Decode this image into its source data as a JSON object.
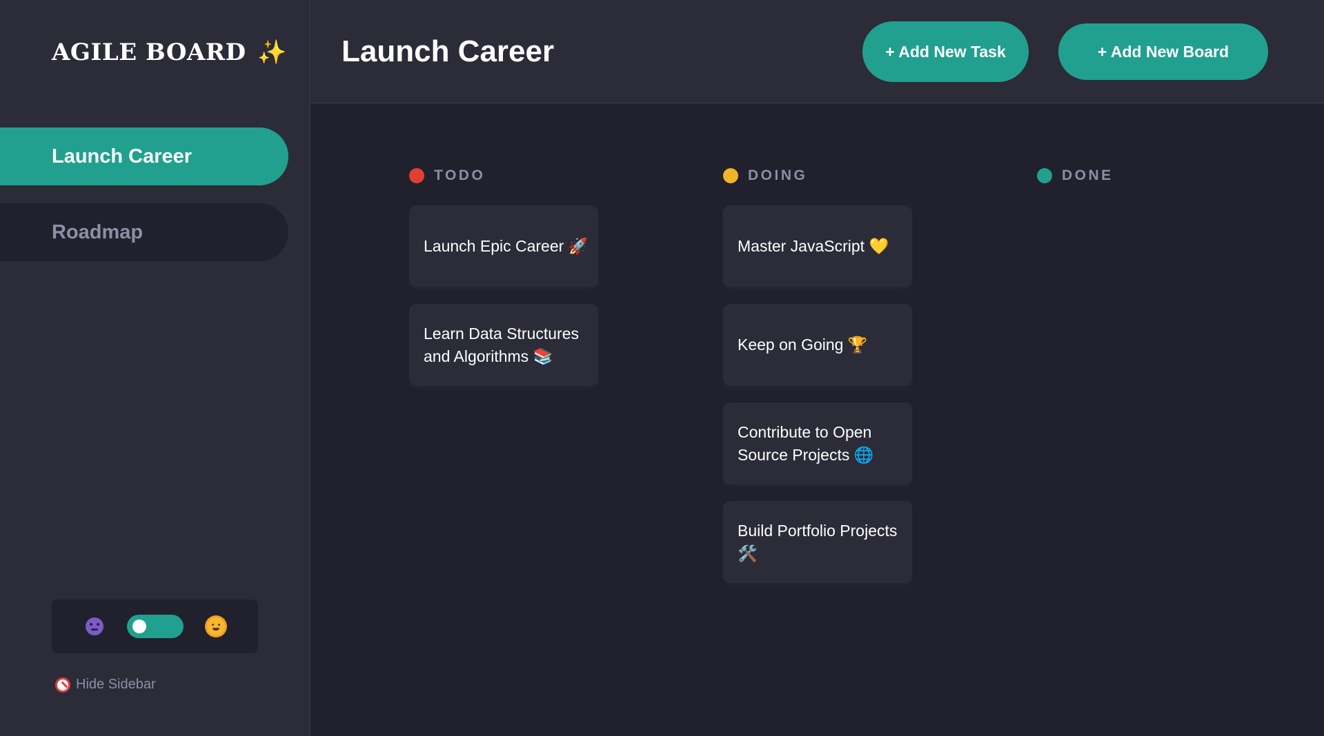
{
  "app": {
    "logo_text": "AGILE BOARD",
    "logo_emoji": "✨"
  },
  "sidebar": {
    "boards": [
      {
        "label": "Launch Career",
        "active": true
      },
      {
        "label": "Roadmap",
        "active": false
      }
    ],
    "theme": {
      "dark_icon": "moon-face-icon",
      "light_icon": "sun-face-icon",
      "toggle_on": true
    },
    "hide_label": "Hide Sidebar",
    "hide_icon": "no-entry-icon"
  },
  "header": {
    "title": "Launch Career",
    "add_task_label": "+ Add New Task",
    "add_board_label": "+ Add New Board"
  },
  "colors": {
    "accent": "#21a08f",
    "todo": "#e23f31",
    "doing": "#f0b429",
    "done": "#21a08f",
    "background": "#20212c",
    "panel": "#2b2c37"
  },
  "columns": [
    {
      "name": "TODO",
      "tasks": [
        "Launch Epic Career 🚀",
        "Learn Data Structures and Algorithms 📚"
      ]
    },
    {
      "name": "DOING",
      "tasks": [
        "Master JavaScript 💛",
        "Keep on Going 🏆",
        "Contribute to Open Source Projects 🌐",
        "Build Portfolio Projects 🛠️"
      ]
    },
    {
      "name": "DONE",
      "tasks": []
    }
  ]
}
